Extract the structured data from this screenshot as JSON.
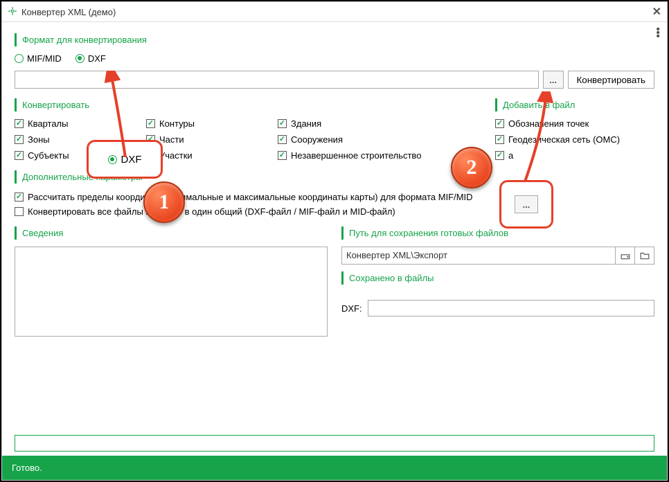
{
  "window": {
    "title": "Конвертер XML (демо)"
  },
  "sections": {
    "format": "Формат для конвертирования",
    "convert": "Конвертировать",
    "addToFile": "Добавить в файл",
    "extraParams": "Дополнительные параметры",
    "info": "Сведения",
    "savePath": "Путь для сохранения готовых файлов",
    "savedTo": "Сохранено в файлы"
  },
  "radios": {
    "mif": "MIF/MID",
    "dxf": "DXF"
  },
  "buttons": {
    "browse": "...",
    "convert": "Конвертировать"
  },
  "checks": {
    "col1": [
      "Кварталы",
      "Зоны",
      "Субъекты"
    ],
    "col2": [
      "Контуры",
      "Части",
      "Участки"
    ],
    "col3": [
      "Здания",
      "Сооружения",
      "Незавершенное строительство"
    ],
    "add": [
      "Обозначения точек",
      "Геодезическая сеть (OMC)",
      "а"
    ],
    "calcBounds": "Рассчитать пределы координат (минимальные и максимальные координаты карты) для формата MIF/MID",
    "mergeArchive": "Конвертировать все файлы в архиве в один общий (DXF-файл / MIF-файл и MID-файл)"
  },
  "savePathValue": "Конвертер XML\\Экспорт",
  "dxfLabel": "DXF:",
  "status": "Готово.",
  "annotations": {
    "callout1": "1",
    "callout2": "2",
    "calloutRadioLabel": "DXF",
    "calloutBrowse": "..."
  }
}
